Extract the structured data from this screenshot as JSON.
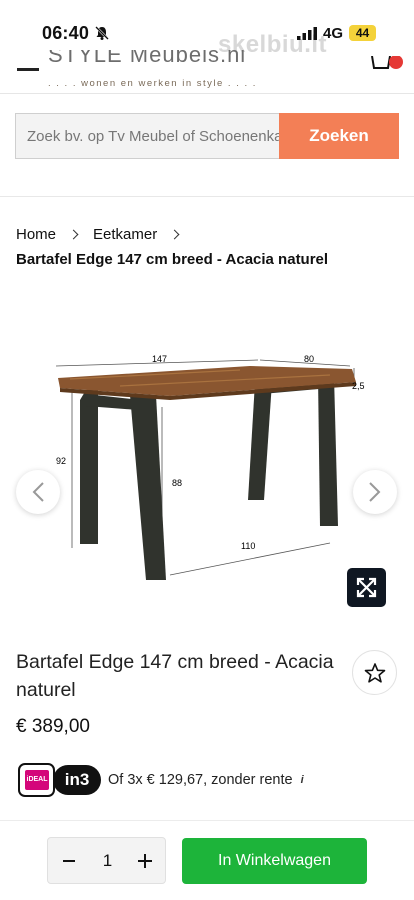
{
  "status_bar": {
    "time": "06:40",
    "network": "4G",
    "battery": "44",
    "watermark": "skelbiu.lt"
  },
  "header": {
    "logo_name": "STYLE Meubels.nl",
    "logo_tagline": ". . . . wonen en werken in style . . . ."
  },
  "search": {
    "placeholder": "Zoek bv. op Tv Meubel of Schoenenkast",
    "button_label": "Zoeken"
  },
  "breadcrumb": {
    "items": [
      "Home",
      "Eetkamer"
    ],
    "current": "Bartafel Edge 147 cm breed - Acacia naturel"
  },
  "image": {
    "dimensions": {
      "width": "147",
      "depth": "80",
      "thickness": "2,5",
      "height": "92",
      "leg_height": "88",
      "leg_spacing": "110"
    }
  },
  "product": {
    "title": "Bartafel Edge 147 cm breed - Acacia naturel",
    "price": "€ 389,00"
  },
  "payment": {
    "ideal_label": "iDEAL",
    "in3_label": "in3",
    "installment_text": "Of 3x € 129,67, zonder rente"
  },
  "cart": {
    "quantity": "1",
    "add_label": "In Winkelwagen"
  },
  "colors": {
    "search_button": "#f37f56",
    "add_to_cart": "#1db43a",
    "table_top": "#8a5630",
    "legs": "#30332d"
  }
}
